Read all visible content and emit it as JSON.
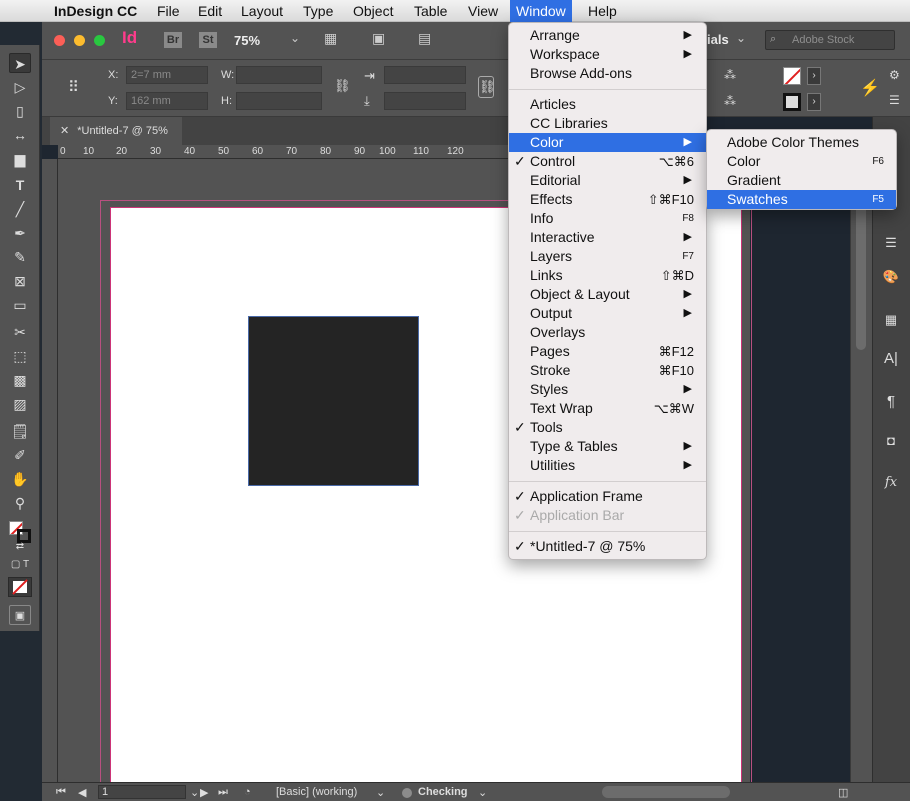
{
  "menubar": {
    "apple": "",
    "app_name": "InDesign CC",
    "items": [
      "File",
      "Edit",
      "Layout",
      "Type",
      "Object",
      "Table",
      "View",
      "Window",
      "Help"
    ],
    "active": "Window"
  },
  "appbar": {
    "logo": "Id",
    "bridge": "Br",
    "stock_app": "St",
    "zoom": "75%",
    "workspace": "ials",
    "search_placeholder": "Adobe Stock"
  },
  "control": {
    "x_label": "X:",
    "y_label": "Y:",
    "w_label": "W:",
    "h_label": "H:",
    "x_value": "2=7 mm",
    "y_value": "162 mm"
  },
  "document": {
    "tab_title": "*Untitled-7 @ 75%"
  },
  "ruler_ticks": [
    "0",
    "10",
    "20",
    "30",
    "40",
    "50",
    "60",
    "70",
    "80",
    "90",
    "100",
    "110",
    "120"
  ],
  "window_menu": {
    "groups": [
      [
        {
          "label": "Arrange",
          "submenu": true
        },
        {
          "label": "Workspace",
          "submenu": true
        },
        {
          "label": "Browse Add-ons"
        }
      ],
      [
        {
          "label": "Articles"
        },
        {
          "label": "CC Libraries"
        },
        {
          "label": "Color",
          "submenu": true,
          "highlighted": true
        },
        {
          "label": "Control",
          "checked": true,
          "shortcut": "⌥⌘6"
        },
        {
          "label": "Editorial",
          "submenu": true
        },
        {
          "label": "Effects",
          "shortcut": "⇧⌘F10"
        },
        {
          "label": "Info",
          "shortcut": "F8"
        },
        {
          "label": "Interactive",
          "submenu": true
        },
        {
          "label": "Layers",
          "shortcut": "F7"
        },
        {
          "label": "Links",
          "shortcut": "⇧⌘D"
        },
        {
          "label": "Object & Layout",
          "submenu": true
        },
        {
          "label": "Output",
          "submenu": true
        },
        {
          "label": "Overlays"
        },
        {
          "label": "Pages",
          "shortcut": "⌘F12"
        },
        {
          "label": "Stroke",
          "shortcut": "⌘F10"
        },
        {
          "label": "Styles",
          "submenu": true
        },
        {
          "label": "Text Wrap",
          "shortcut": "⌥⌘W"
        },
        {
          "label": "Tools",
          "checked": true
        },
        {
          "label": "Type & Tables",
          "submenu": true
        },
        {
          "label": "Utilities",
          "submenu": true
        }
      ],
      [
        {
          "label": "Application Frame",
          "checked": true
        },
        {
          "label": "Application Bar",
          "checked": true,
          "disabled": true
        }
      ],
      [
        {
          "label": "*Untitled-7 @ 75%",
          "checked": true
        }
      ]
    ]
  },
  "color_submenu": [
    {
      "label": "Adobe Color Themes"
    },
    {
      "label": "Color",
      "shortcut": "F6"
    },
    {
      "label": "Gradient"
    },
    {
      "label": "Swatches",
      "shortcut": "F5",
      "highlighted": true
    }
  ],
  "status": {
    "page": "1",
    "style": "[Basic] (working)",
    "preflight": "Checking"
  },
  "colors": {
    "highlight": "#2f6fe3",
    "menu_bg": "#f0eced",
    "ui_gray": "#535353",
    "bleed_guide": "#cc3377",
    "rectangle_fill": "#242424"
  }
}
